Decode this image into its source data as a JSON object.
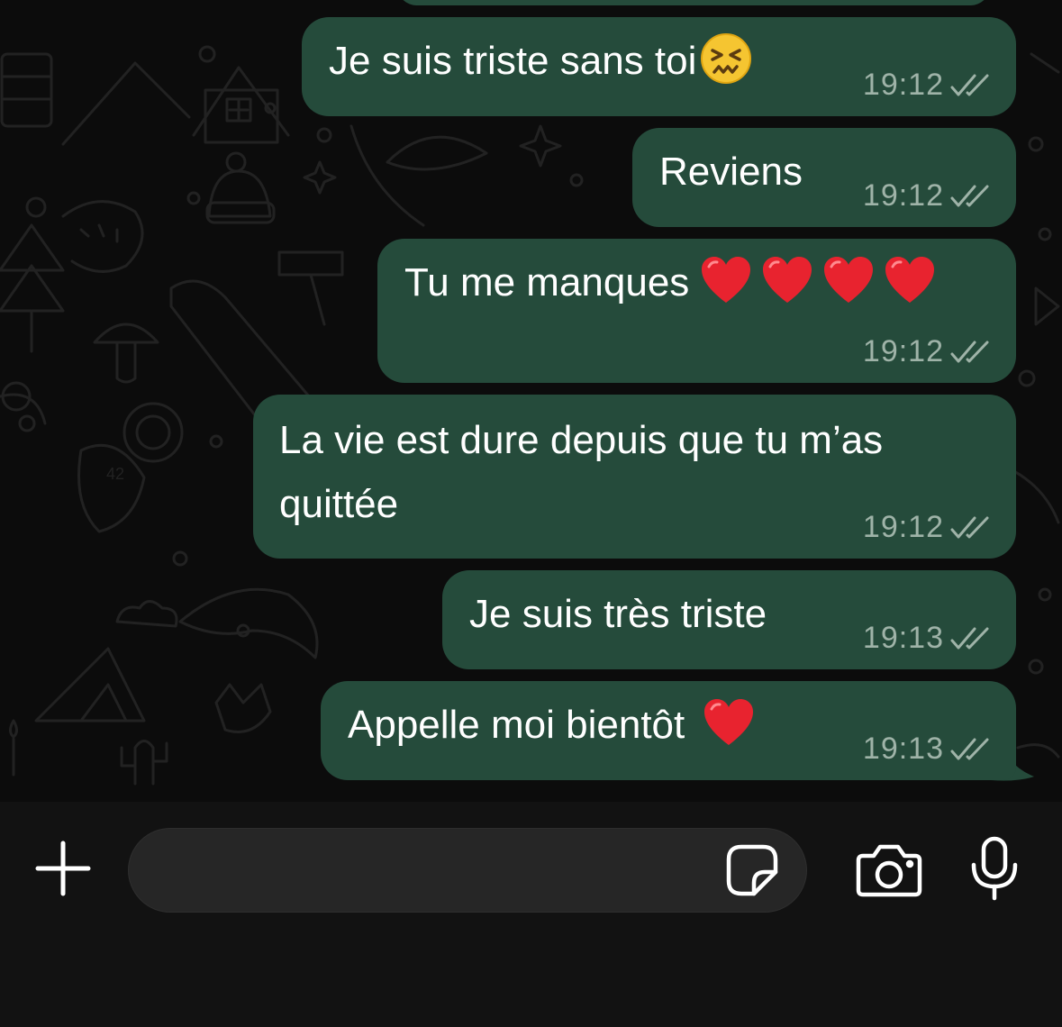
{
  "messages": [
    {
      "text": "Je suis triste sans toi",
      "emoji": "confounded-face",
      "time": "19:12",
      "status": "delivered"
    },
    {
      "text": "Reviens",
      "time": "19:12",
      "status": "delivered"
    },
    {
      "text": "Tu me manques",
      "emoji": "red-heart x4",
      "time": "19:12",
      "status": "delivered"
    },
    {
      "text_line1": "La vie est dure depuis que tu m’as",
      "text_line2": "quittée",
      "time": "19:12",
      "status": "delivered"
    },
    {
      "text": "Je suis très triste",
      "time": "19:13",
      "status": "delivered"
    },
    {
      "text": "Appelle moi bientôt",
      "emoji": "red-heart",
      "time": "19:13",
      "status": "delivered"
    }
  ],
  "composer": {
    "placeholder": "",
    "icons": [
      "plus-icon",
      "sticker-icon",
      "camera-icon",
      "microphone-icon"
    ]
  },
  "colors": {
    "bubble_outgoing": "#254b3b",
    "chat_background": "#0c0c0c",
    "composer_background": "#121212",
    "input_background": "#262626",
    "time_text": "#9fb3a8"
  }
}
